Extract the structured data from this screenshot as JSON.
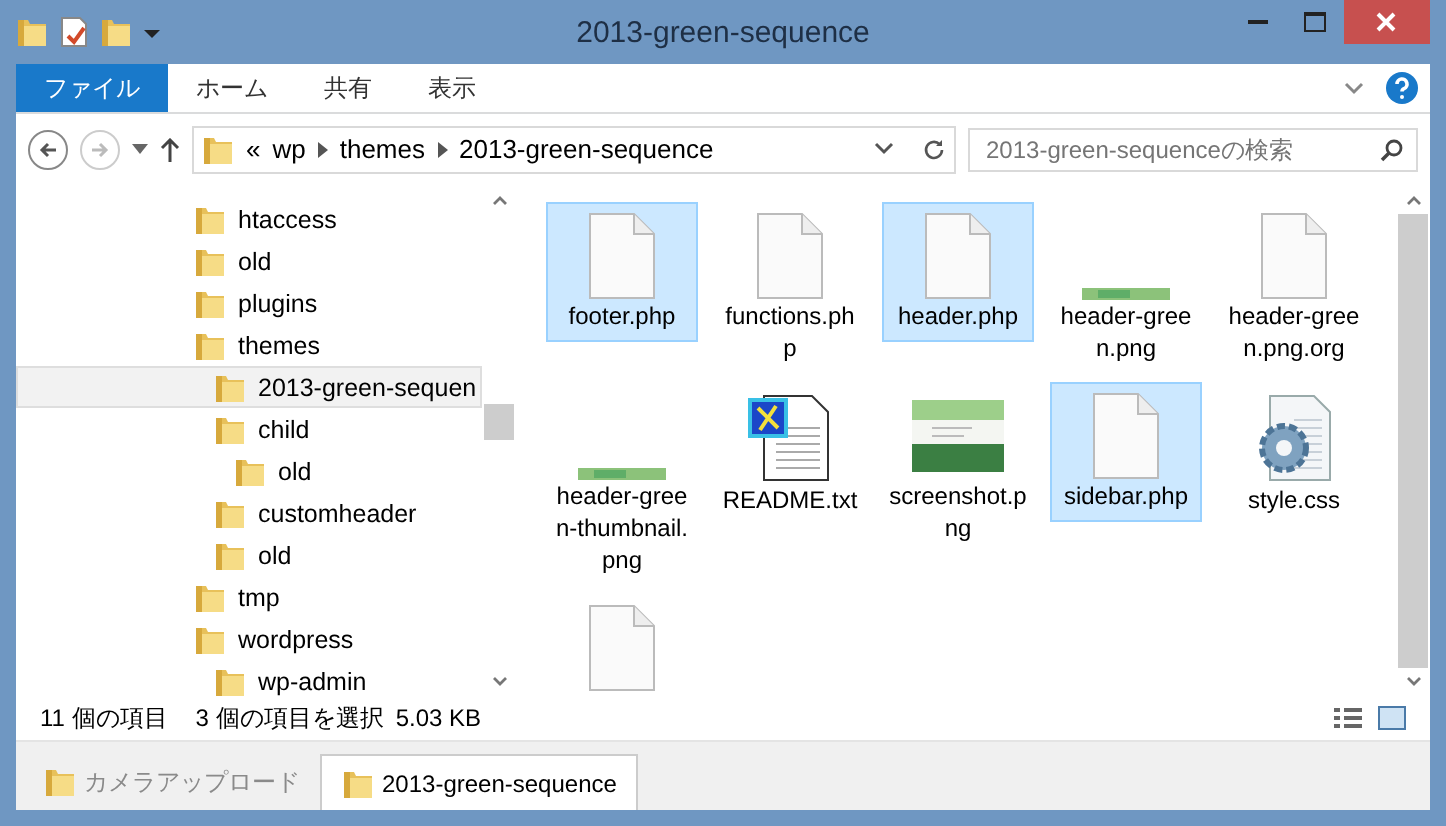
{
  "window": {
    "title": "2013-green-sequence"
  },
  "ribbon_tabs": [
    {
      "label": "ファイル",
      "kind": "file"
    },
    {
      "label": "ホーム",
      "kind": "tab"
    },
    {
      "label": "共有",
      "kind": "tab"
    },
    {
      "label": "表示",
      "kind": "tab"
    }
  ],
  "address_bar": {
    "overflow": "«",
    "path": [
      "wp",
      "themes",
      "2013-green-sequence"
    ]
  },
  "search": {
    "placeholder": "2013-green-sequenceの検索"
  },
  "navigation_tree": [
    {
      "label": "htaccess",
      "selected": false
    },
    {
      "label": "old",
      "selected": false
    },
    {
      "label": "plugins",
      "selected": false
    },
    {
      "label": "themes",
      "selected": false,
      "children": [
        {
          "label": "2013-green-sequen",
          "selected": true
        },
        {
          "label": "child",
          "selected": false,
          "children": [
            {
              "label": "old",
              "selected": false
            }
          ]
        },
        {
          "label": "customheader",
          "selected": false
        },
        {
          "label": "old",
          "selected": false
        }
      ]
    },
    {
      "label": "tmp",
      "selected": false
    },
    {
      "label": "wordpress",
      "selected": false,
      "children": [
        {
          "label": "wp-admin",
          "selected": false
        }
      ]
    }
  ],
  "files": [
    {
      "name": "footer.php",
      "kind": "blank",
      "selected": true
    },
    {
      "name": "functions.php",
      "kind": "blank",
      "selected": false
    },
    {
      "name": "header.php",
      "kind": "blank",
      "selected": true
    },
    {
      "name": "header-green.png",
      "kind": "banner",
      "selected": false
    },
    {
      "name": "header-green.png.org",
      "kind": "blank",
      "selected": false
    },
    {
      "name": "header-green-thumbnail.png",
      "kind": "banner",
      "selected": false
    },
    {
      "name": "README.txt",
      "kind": "readme",
      "selected": false
    },
    {
      "name": "screenshot.png",
      "kind": "screenshot",
      "selected": false
    },
    {
      "name": "sidebar.php",
      "kind": "blank",
      "selected": true
    },
    {
      "name": "style.css",
      "kind": "css",
      "selected": false
    },
    {
      "kind": "blank",
      "selected": false
    }
  ],
  "status_bar": {
    "item_count": "11 個の項目",
    "selection": "3 個の項目を選択",
    "size": "5.03 KB"
  },
  "window_tabs": [
    {
      "label": "カメラアップロード",
      "selected": false
    },
    {
      "label": "2013-green-sequence",
      "selected": true
    }
  ]
}
